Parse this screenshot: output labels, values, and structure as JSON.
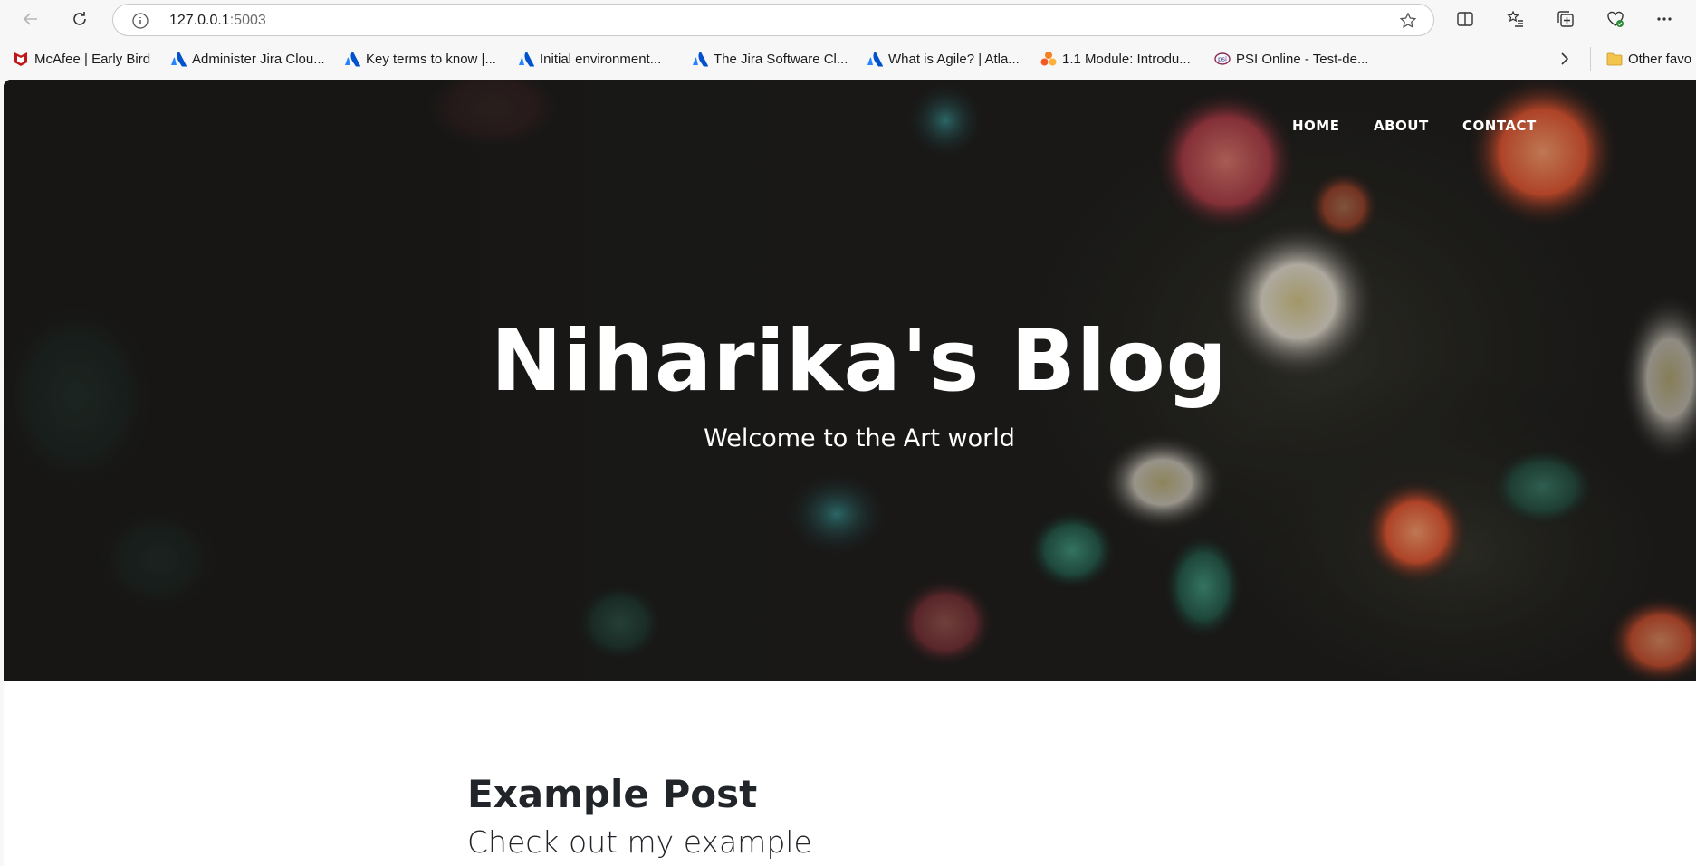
{
  "browser": {
    "url_host": "127.0.0.1",
    "url_port": ":5003",
    "favorites": [
      {
        "label": "McAfee | Early Bird",
        "icon": "mcafee-icon"
      },
      {
        "label": "Administer Jira Clou...",
        "icon": "atlassian-icon"
      },
      {
        "label": "Key terms to know |...",
        "icon": "atlassian-icon"
      },
      {
        "label": "Initial environment...",
        "icon": "atlassian-icon"
      },
      {
        "label": "The Jira Software Cl...",
        "icon": "atlassian-icon"
      },
      {
        "label": "What is Agile? | Atla...",
        "icon": "atlassian-icon"
      },
      {
        "label": "1.1 Module: Introdu...",
        "icon": "orange-app-icon"
      },
      {
        "label": "PSI Online - Test-de...",
        "icon": "psi-icon"
      }
    ],
    "other_favorites": "Other favo"
  },
  "site": {
    "nav": [
      "HOME",
      "ABOUT",
      "CONTACT"
    ],
    "title": "Niharika's Blog",
    "subtitle": "Welcome to the Art world"
  },
  "post": {
    "title": "Example Post",
    "subtitle": "Check out my example"
  },
  "colors": {
    "hero_bg": "#1c1b1a",
    "text_dark": "#212529",
    "atlassian_blue": "#2684ff",
    "mcafee_red": "#c01818"
  }
}
